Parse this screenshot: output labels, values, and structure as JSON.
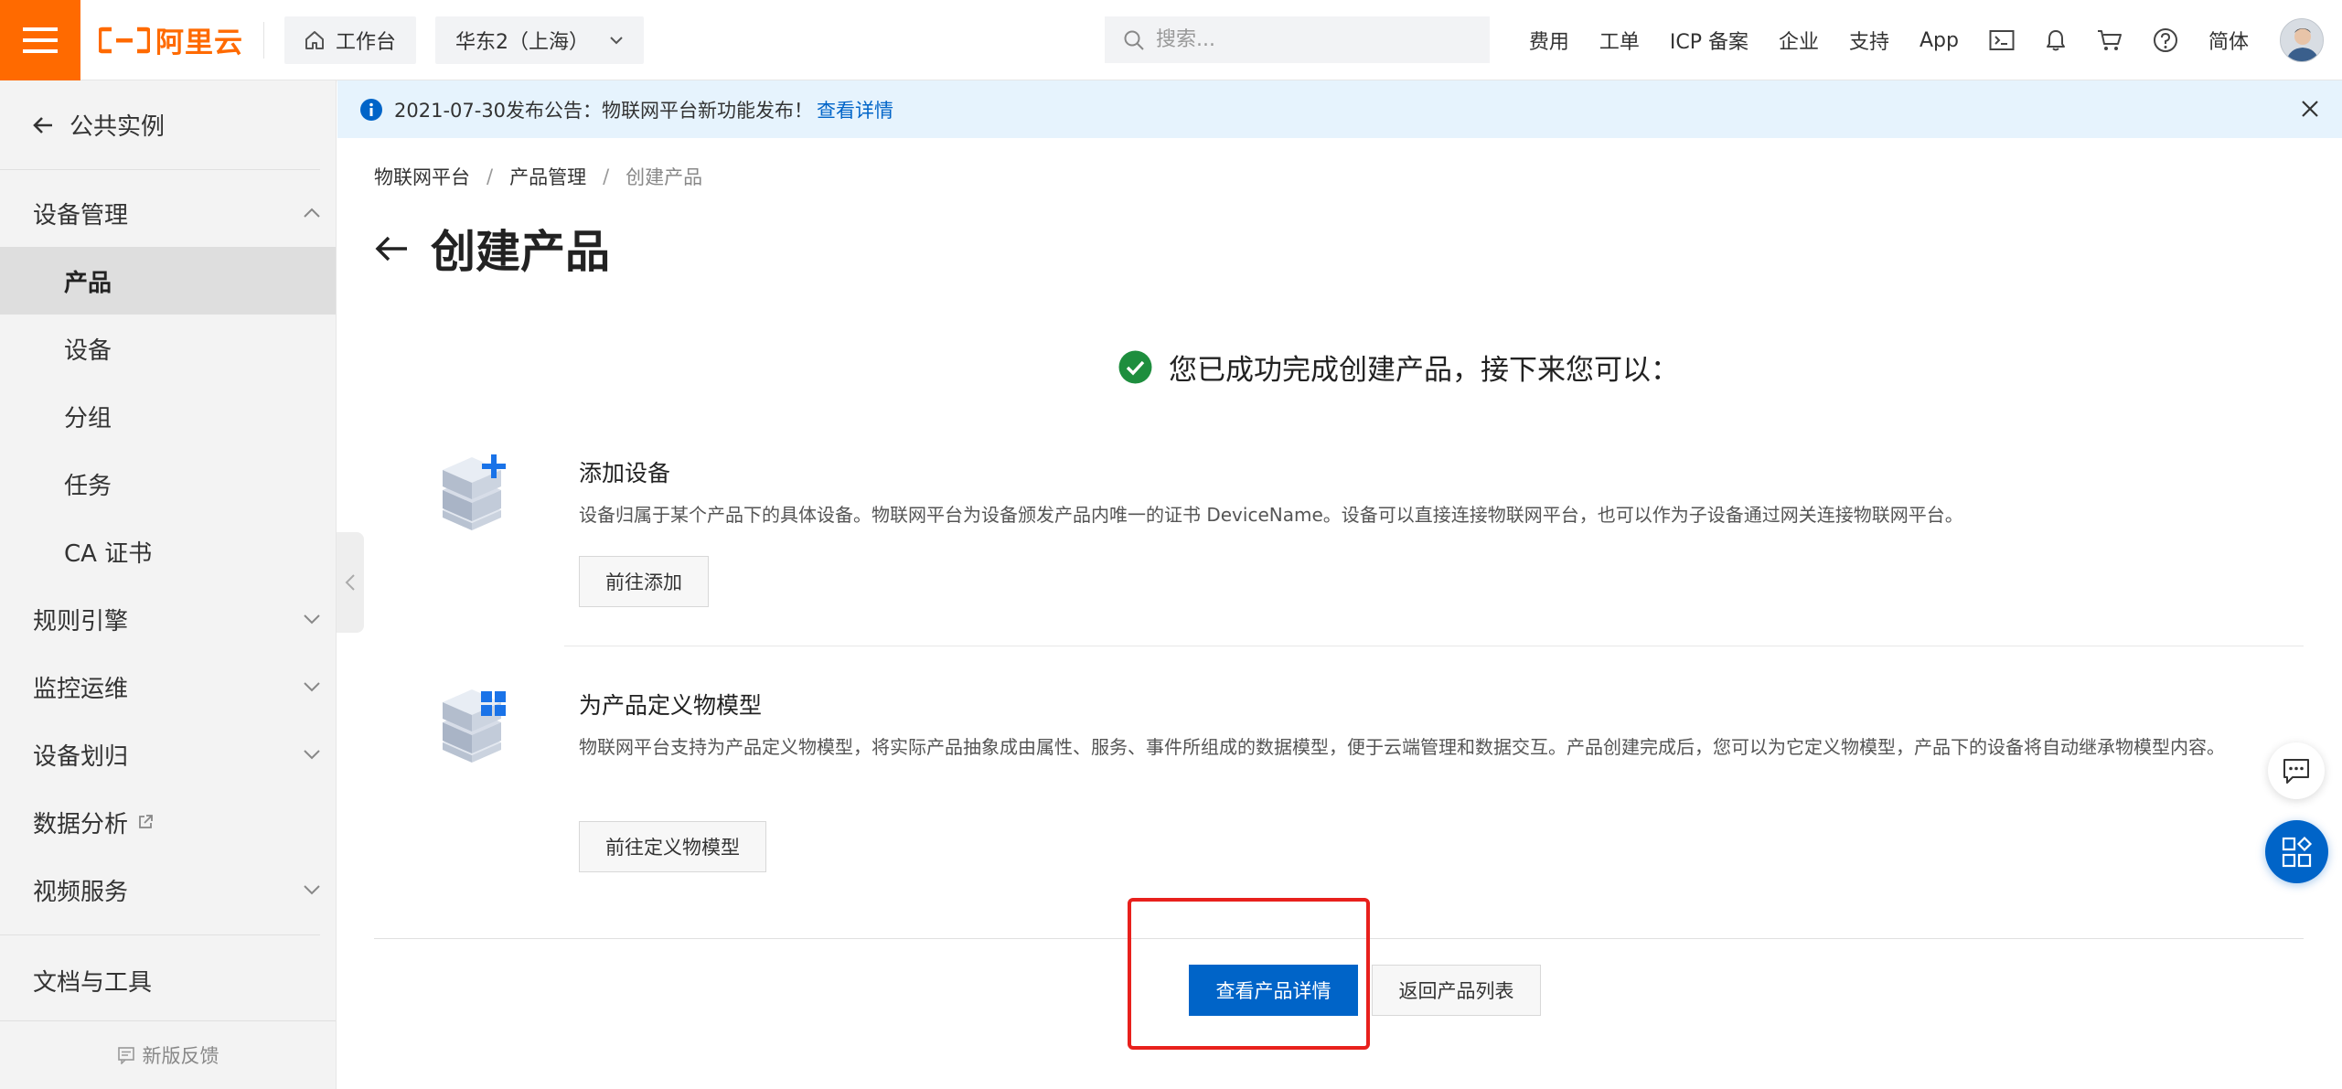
{
  "topbar": {
    "logo_text": "阿里云",
    "workbench_label": "工作台",
    "region_label": "华东2（上海）",
    "search_placeholder": "搜索...",
    "links": {
      "cost": "费用",
      "ticket": "工单",
      "icp": "ICP 备案",
      "enterprise": "企业",
      "support": "支持",
      "app": "App",
      "language": "简体"
    },
    "brand_color": "#ff6a00"
  },
  "sidebar": {
    "back_label": "公共实例",
    "groups": {
      "device_mgmt": "设备管理",
      "rules": "规则引擎",
      "monitor": "监控运维",
      "allocation": "设备划归",
      "analytics": "数据分析",
      "video": "视频服务",
      "docs": "文档与工具"
    },
    "items": {
      "product": "产品",
      "device": "设备",
      "group": "分组",
      "task": "任务",
      "ca": "CA 证书"
    },
    "feedback": "新版反馈"
  },
  "notice": {
    "text": "2021-07-30发布公告：物联网平台新功能发布！",
    "link": "查看详情"
  },
  "breadcrumb": {
    "root": "物联网平台",
    "parent": "产品管理",
    "current": "创建产品"
  },
  "page": {
    "title": "创建产品",
    "success_message": "您已成功完成创建产品，接下来您可以："
  },
  "steps": {
    "add_device": {
      "title": "添加设备",
      "desc": "设备归属于某个产品下的具体设备。物联网平台为设备颁发产品内唯一的证书 DeviceName。设备可以直接连接物联网平台，也可以作为子设备通过网关连接物联网平台。",
      "button": "前往添加"
    },
    "define_model": {
      "title": "为产品定义物模型",
      "desc": "物联网平台支持为产品定义物模型，将实际产品抽象成由属性、服务、事件所组成的数据模型，便于云端管理和数据交互。产品创建完成后，您可以为它定义物模型，产品下的设备将自动继承物模型内容。",
      "button": "前往定义物模型"
    }
  },
  "actions": {
    "view_detail": "查看产品详情",
    "back_to_list": "返回产品列表"
  },
  "colors": {
    "primary": "#0064c8",
    "success": "#1e8e3e",
    "highlight": "#e8201c"
  }
}
